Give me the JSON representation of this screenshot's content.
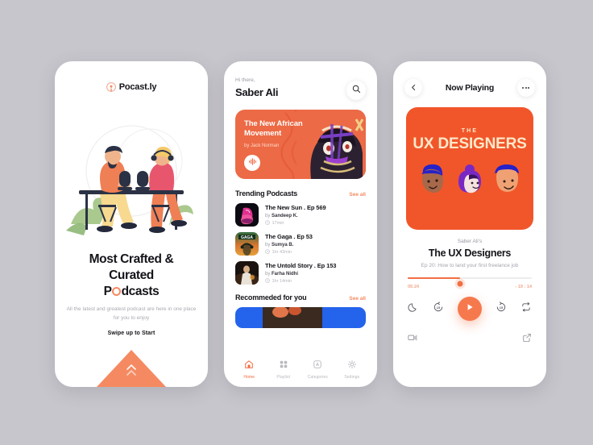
{
  "meta": {
    "background_color": "#c7c6cc",
    "accent_color": "#f16f44",
    "accent_soft": "#f58a62"
  },
  "screen1": {
    "logo_text": "Pocast.ly",
    "title_line1": "Most Crafted & Curated",
    "title_before_ring": "P",
    "title_after_ring": "dcasts",
    "subtitle": "All the latest and greatest podcast are here in one place for you to enjoy",
    "swipe_label": "Swipe up to Start"
  },
  "screen2": {
    "greeting": "Hi there,",
    "user_name": "Saber Ali",
    "search_placeholder": "Search",
    "feature": {
      "title": "The New African Movement",
      "by": "by Jack Norman"
    },
    "trending": {
      "heading": "Trending Podcasts",
      "see_all": "See all",
      "items": [
        {
          "name": "The New Sun . Ep 569",
          "by_prefix": "by",
          "author": "Sandeep K.",
          "duration": "17min"
        },
        {
          "name": "The Gaga . Ep 53",
          "by_prefix": "by",
          "author": "Sumya B.",
          "duration": "1hr 43min"
        },
        {
          "name": "The Untold Story . Ep 153",
          "by_prefix": "by",
          "author": "Farha Nidhi",
          "duration": "1hr 14min"
        }
      ]
    },
    "recommended": {
      "heading": "Recommeded for you",
      "see_all": "See all"
    },
    "tabs": [
      {
        "label": "Home",
        "icon": "home-icon",
        "active": true
      },
      {
        "label": "Playlist",
        "icon": "grid-icon",
        "active": false
      },
      {
        "label": "Categories",
        "icon": "categories-icon",
        "active": false
      },
      {
        "label": "Settings",
        "icon": "gear-icon",
        "active": false
      }
    ]
  },
  "screen3": {
    "header_title": "Now Playing",
    "back_icon": "chevron-left-icon",
    "more_icon": "more-dots-icon",
    "album": {
      "the": "THE",
      "main": "UX DESIGNERS"
    },
    "owner": "Saber Ali's",
    "track_title": "The UX Designers",
    "episode": "Ep 20: How to land your first freelance job",
    "time_elapsed": "05:24",
    "time_remaining": "- 19 : 14",
    "progress_percent": 42,
    "controls": [
      {
        "icon": "moon-icon",
        "name": "sleep-timer-button"
      },
      {
        "icon": "rewind-15-icon",
        "name": "rewind-button"
      },
      {
        "icon": "play-icon",
        "name": "play-button"
      },
      {
        "icon": "forward-15-icon",
        "name": "forward-button"
      },
      {
        "icon": "repeat-icon",
        "name": "repeat-button"
      }
    ],
    "bottom_controls": [
      {
        "icon": "cast-icon",
        "name": "cast-button"
      },
      {
        "icon": "share-icon",
        "name": "share-button"
      }
    ]
  }
}
